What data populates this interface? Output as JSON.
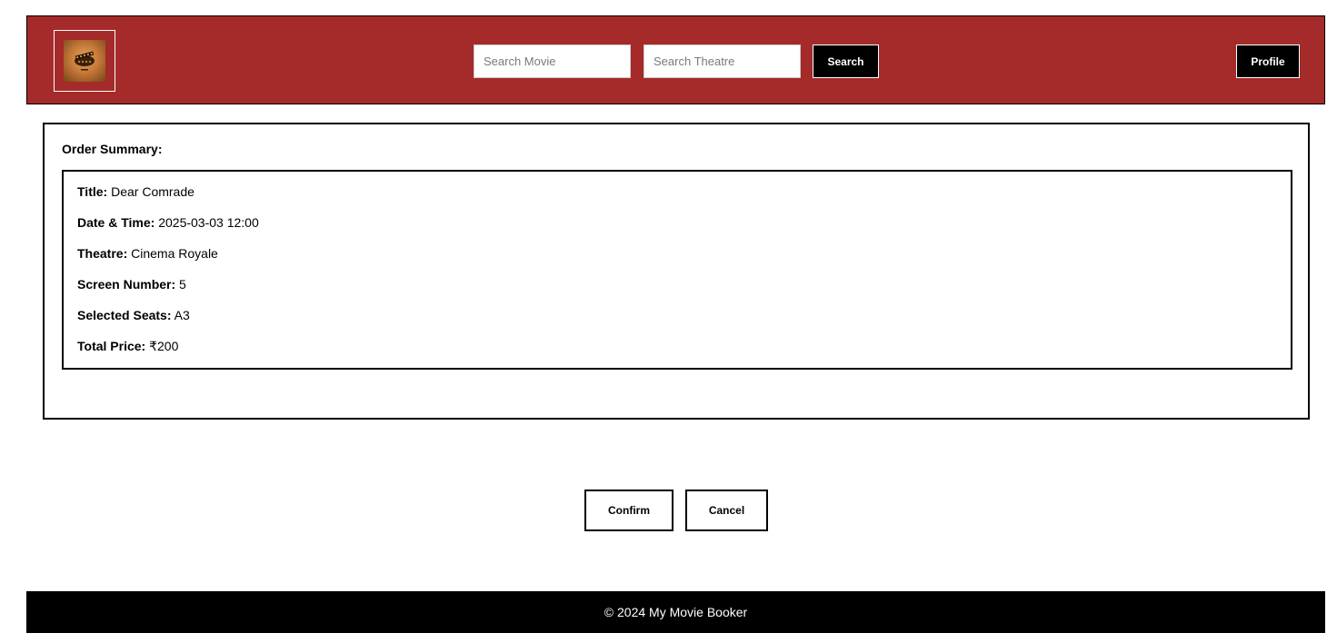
{
  "header": {
    "logo_icon": "movie-logo",
    "search_movie": {
      "placeholder": "Search Movie",
      "value": ""
    },
    "search_theatre": {
      "placeholder": "Search Theatre",
      "value": ""
    },
    "search_label": "Search",
    "profile_label": "Profile",
    "colors": {
      "background": "#a52a2a",
      "button": "#000000"
    }
  },
  "summary": {
    "heading": "Order Summary:",
    "rows": [
      {
        "label": "Title:",
        "value": "Dear Comrade"
      },
      {
        "label": "Date & Time:",
        "value": "2025-03-03 12:00"
      },
      {
        "label": "Theatre:",
        "value": "Cinema Royale"
      },
      {
        "label": "Screen Number:",
        "value": "5"
      },
      {
        "label": "Selected Seats:",
        "value": "A3"
      },
      {
        "label": "Total Price:",
        "value": "₹200"
      }
    ]
  },
  "actions": {
    "confirm_label": "Confirm",
    "cancel_label": "Cancel"
  },
  "footer": {
    "text": "© 2024 My Movie Booker",
    "background": "#000000"
  }
}
